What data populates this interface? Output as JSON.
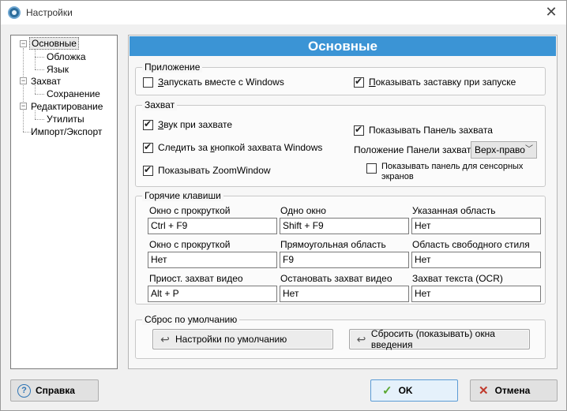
{
  "window": {
    "title": "Настройки"
  },
  "nav": {
    "items": [
      {
        "label": "Основные"
      },
      {
        "label": "Обложка"
      },
      {
        "label": "Язык"
      },
      {
        "label": "Захват"
      },
      {
        "label": "Сохранение"
      },
      {
        "label": "Редактирование"
      },
      {
        "label": "Утилиты"
      },
      {
        "label": "Импорт/Экспорт"
      }
    ],
    "selected": "Основные"
  },
  "main": {
    "header": "Основные",
    "app_group": {
      "title": "Приложение",
      "start_with_windows": {
        "prefix": "З",
        "rest": "апускать вместе с Windows",
        "checked": false
      },
      "show_splash": {
        "prefix": "П",
        "rest": "оказывать заставку при запуске",
        "checked": true
      }
    },
    "capture_group": {
      "title": "Захват",
      "sound": {
        "prefix": "З",
        "rest": "вук при захвате",
        "checked": true
      },
      "follow_button": {
        "pre": "Следить за ",
        "underlined": "к",
        "rest": "нопкой захвата Windows",
        "checked": true
      },
      "zoom_window": {
        "label": "Показывать ZoomWindow",
        "checked": true
      },
      "show_panel": {
        "label": "Показывать Панель захвата",
        "checked": true
      },
      "panel_position_label": "Положение Панели захвата",
      "panel_position_value": "Верх-право",
      "touch_panel": {
        "label_line1": "Показывать панель для сенсорных",
        "label_line2": "экранов",
        "checked": false
      }
    },
    "hotkeys_group": {
      "title": "Горячие клавиши",
      "rows": [
        [
          {
            "label": "Окно с прокруткой",
            "value": "Ctrl + F9"
          },
          {
            "label": "Одно окно",
            "value": "Shift + F9"
          },
          {
            "label": "Указанная область",
            "value": "Нет"
          }
        ],
        [
          {
            "label": "Окно с прокруткой",
            "value": "Нет"
          },
          {
            "label": "Прямоугольная область",
            "value": "F9"
          },
          {
            "label": "Область свободного стиля",
            "value": "Нет"
          }
        ],
        [
          {
            "label": "Приост. захват видео",
            "value": "Alt + P"
          },
          {
            "label": "Остановать захват видео",
            "value": "Нет"
          },
          {
            "label": "Захват текста (OCR)",
            "value": "Нет"
          }
        ]
      ]
    },
    "reset_group": {
      "title": "Сброс по умолчанию",
      "defaults_button": "Настройки по умолчанию",
      "reset_intro_button": "Сбросить (показывать) окна введения"
    }
  },
  "footer": {
    "help": "Справка",
    "ok": "OK",
    "cancel": "Отмена"
  }
}
